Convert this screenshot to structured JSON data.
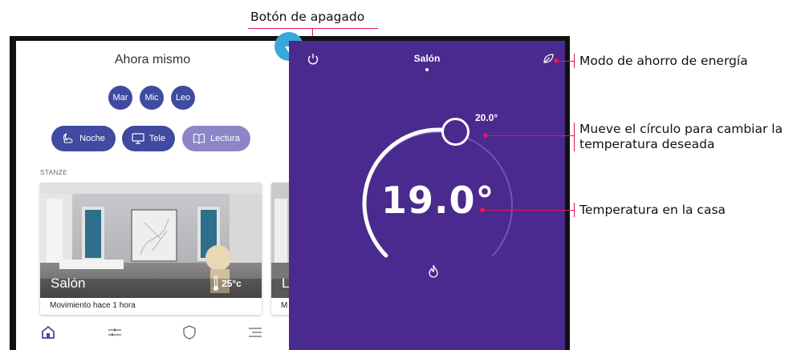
{
  "annotations": {
    "power_button": "Botón de apagado",
    "energy_saving": "Modo de ahorro de energía",
    "move_circle_line1": "Mueve el círculo para cambiar la",
    "move_circle_line2": "temperatura deseada",
    "house_temp": "Temperatura en la casa"
  },
  "left_panel": {
    "title": "Ahora mismo",
    "people": [
      "Mar",
      "Mic",
      "Leo"
    ],
    "scenes": [
      {
        "label": "Noche",
        "icon": "moon-cloud-icon"
      },
      {
        "label": "Tele",
        "icon": "tv-icon"
      },
      {
        "label": "Lectura",
        "icon": "book-icon"
      }
    ],
    "section_label": "STANZE",
    "room_card": {
      "name": "Salón",
      "temperature": "25°c",
      "note": "Movimiento hace 1 hora"
    },
    "second_card": {
      "name": "L",
      "note": "M"
    },
    "nav_icons": [
      "home-icon",
      "sliders-icon",
      "shield-icon",
      "menu-icon"
    ]
  },
  "thermostat": {
    "room": "Salón",
    "current_temp": "19.0°",
    "target_temp": "20.0°",
    "target_fraction": 0.55,
    "mode_icon": "flame-icon"
  },
  "colors": {
    "accent": "#e3175c",
    "thermostat_bg": "#4a2a8e",
    "chip": "#3f4aa0",
    "chip_light": "#8c86c8",
    "collapse_button": "#39a8d8"
  }
}
